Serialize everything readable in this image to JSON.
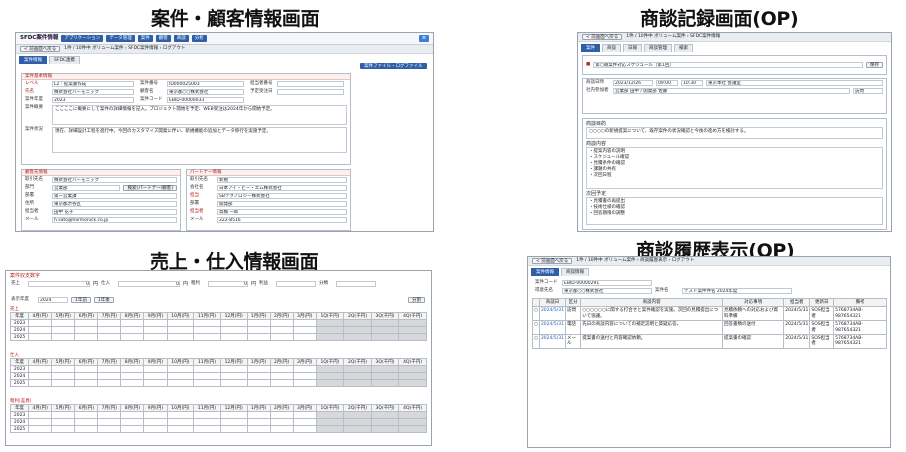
{
  "titles": {
    "t1": "案件・顧客情報画面",
    "t2": "商談記録画面(OP)",
    "t3": "売上・仕入情報画面",
    "t4": "商談履歴表示(OP)"
  },
  "s1": {
    "app_name": "SFDC案件情報",
    "nav": [
      "アプリケーション",
      "データ管理",
      "案件",
      "顧客",
      "商談",
      "分析"
    ],
    "breadcrumb": "1件 / 10件中 ボリューム案件 › SFDC案件情報 › ログアウト",
    "back": "< 前画面へ戻る",
    "tabs": [
      "案件情報",
      "SFDC連携"
    ],
    "tab_button": "案件ファイル・ログファイル",
    "section_title": "案件基本情報",
    "f_level": "レベル",
    "v_level": "L2 : 提案書作成",
    "f_name": "氏名",
    "v_name": "株式会社ハーモニック",
    "f_year": "案件年度",
    "v_year": "2023",
    "f_summary": "案件概要",
    "v_summary": "ここここに概要にして案件の詳細情報を記入。プロジェクト開始を予定、WEB受注は2024年から開始予定。",
    "f_detail": "案件状況",
    "v_detail": "現在、詳細設計工程を進行中。今回のカスタマイズ開発に伴い、新規機能の追加とデータ移行を実施予定。",
    "f_project_no": "案件番号",
    "v_project_no": "ID000025003",
    "f_customer": "顧客名",
    "v_customer": "東京都○○株式会社",
    "f_code": "案件コード",
    "v_code": "EBID-00000033",
    "f_owner": "担当者番号",
    "f_due": "予定受注日",
    "client_title": "顧客先情報",
    "client_rows": [
      [
        "取引先名",
        "株式会社ハーモニック"
      ],
      [
        "部門",
        "営業部"
      ],
      [
        "部署",
        "第一営業課"
      ],
      [
        "住所",
        "東京都渋谷区"
      ],
      [
        "担当者",
        "田中 花子"
      ],
      [
        "メール",
        "h.sato@harmonick.co.jp"
      ]
    ],
    "partner_title": "パートナー情報",
    "partner_rows": [
      [
        "取引先名",
        "新規"
      ],
      [
        "会社名",
        "日本アイ・ビー・エム株式会社"
      ],
      [
        "担当",
        "SBテクノロジー株式会社"
      ],
      [
        "部署",
        "開発部"
      ],
      [
        "担当者",
        "高橋 一郎"
      ],
      [
        "メール",
        "222-8516"
      ]
    ],
    "search_button": "検索(パートナー/顧客)"
  },
  "s2": {
    "back": "< 前画面へ戻る",
    "breadcrumb": "1件 / 10件中 ボリューム案件 › SFDC案件情報",
    "tabs": [
      "案件",
      "商談",
      "日報",
      "商談管理",
      "検索"
    ],
    "topic": "第○期案件対応スケジュール（第1回）",
    "f_date": "商談日時",
    "v_date": "2023/12/26",
    "v_time_from": "09:00",
    "v_time_to": "10:30",
    "v_place": "東京本社 会議室",
    "v_method": "訪問",
    "f_attend": "社内参加者",
    "v_attend": "営業部 田中 / 開発部 佐藤",
    "f_purpose": "商談目的",
    "v_purpose": "○○○○の新規提案について、既存案件の状況確認と今後の進め方を検討する。",
    "f_content": "商談内容",
    "content_lines": [
      "・提案内容の説明",
      "・スケジュール確認",
      "・見積条件の確認",
      "・課題の共有",
      "・次回日程"
    ],
    "f_next": "次回予定",
    "next_lines": [
      "・見積書の再提出",
      "・技術仕様の確認",
      "・回答期限の調整"
    ],
    "save": "保存"
  },
  "s3": {
    "legend": "案件収支数字",
    "f_sales": "売上",
    "f_cost": "仕入",
    "f_profit": "粗利",
    "f_profit_rate": "利益",
    "f_unit": "単位",
    "f_class": "分類",
    "v_sales": "0",
    "v_cost": "0",
    "v_profit": "0",
    "unit": "円",
    "f_year": "表示年度",
    "v_year": "2024",
    "prev_btn": "1年前",
    "next_btn": "1年後",
    "reset_btn": "分割",
    "sec_titles": [
      "売上",
      "仕入",
      "粗利(差異)"
    ],
    "columns": [
      "年度",
      "4月(円)",
      "5月(円)",
      "6月(円)",
      "7月(円)",
      "8月(円)",
      "9月(円)",
      "10月(円)",
      "11月(円)",
      "12月(円)",
      "1月(円)",
      "2月(円)",
      "3月(円)",
      "1Q(千円)",
      "2Q(千円)",
      "3Q(千円)",
      "4Q(千円)"
    ],
    "years": [
      "2023",
      "2024",
      "2025"
    ]
  },
  "s4": {
    "back": "< 前画面へ戻る",
    "breadcrumb": "1件 / 10件中 ボリューム案件 › 商談履歴表示 › ログアウト",
    "tabs": [
      "案件情報",
      "商談情報"
    ],
    "f_code": "案件コード",
    "v_code": "EBID-00000291",
    "f_customer": "得意先名",
    "v_customer": "東京都○○株式会社",
    "f_project": "案件名",
    "v_project": "テスト案件件名 2024年度",
    "columns": [
      "商談日",
      "区分",
      "商談内容",
      "対応事項",
      "担当者",
      "更新日",
      "備考"
    ],
    "rows": [
      [
        "2024/5/31",
        "訪問",
        "○○○○○○に関する打合せと案件確認を実施。次回の見積提出について協議。",
        "見積依頼への対応および資料準備",
        "2024/5/31",
        "SOS担当者",
        "5768734AB-987654321"
      ],
      [
        "2024/5/31",
        "電話",
        "先日の商談内容についての補足説明と質疑応答。",
        "回答書類の送付",
        "2024/5/31",
        "SOS担当者",
        "5768734AB-987654321"
      ],
      [
        "2024/5/31",
        "メール",
        "提案書の送付と内容確認依頼。",
        "提案書の確認",
        "2024/5/31",
        "SOS担当者",
        "5768734AB-987654321"
      ]
    ]
  }
}
